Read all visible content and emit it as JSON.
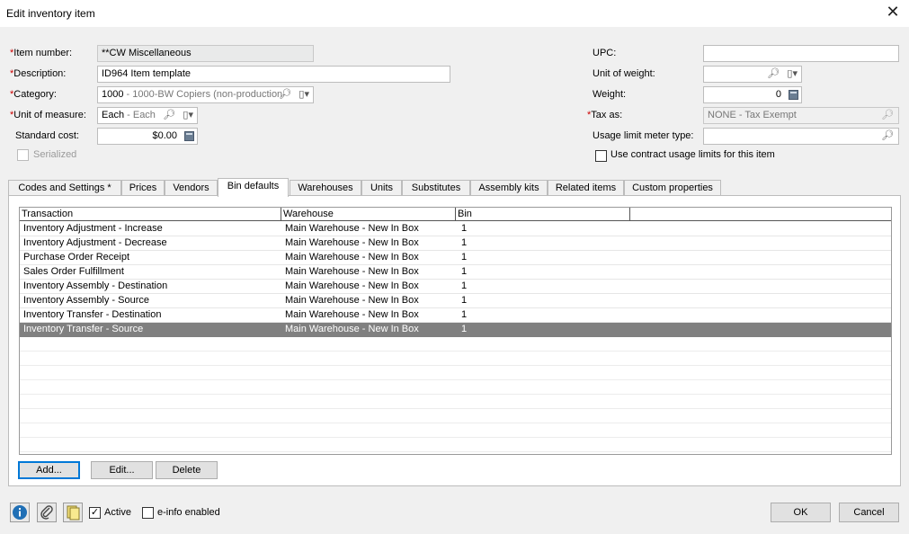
{
  "window": {
    "title": "Edit inventory item",
    "close_glyph": "✕"
  },
  "form": {
    "item_number": {
      "label": "Item number:",
      "value": "**CW Miscellaneous"
    },
    "description": {
      "label": "Description:",
      "value": "ID964 Item template"
    },
    "category": {
      "label": "Category:",
      "code": "1000",
      "name": " - 1000-BW Copiers (non-production"
    },
    "unit_of_measure": {
      "label": "Unit of measure:",
      "code": "Each",
      "name": " - Each"
    },
    "standard_cost": {
      "label": "Standard cost:",
      "value": "$0.00"
    },
    "serialized": {
      "label": "Serialized",
      "checked": false
    },
    "upc": {
      "label": "UPC:",
      "value": ""
    },
    "unit_of_weight": {
      "label": "Unit of weight:",
      "value": ""
    },
    "weight": {
      "label": "Weight:",
      "value": "0"
    },
    "tax_as": {
      "label": "Tax as:",
      "value": "NONE - Tax Exempt"
    },
    "usage_limit_meter_type": {
      "label": "Usage limit meter type:",
      "value": ""
    },
    "contract_usage": {
      "label": "Use contract usage limits for this item",
      "checked": false
    }
  },
  "tabs": [
    {
      "label": "Codes and Settings  *"
    },
    {
      "label": "Prices"
    },
    {
      "label": "Vendors"
    },
    {
      "label": "Bin defaults",
      "active": true
    },
    {
      "label": "Warehouses"
    },
    {
      "label": "Units"
    },
    {
      "label": "Substitutes"
    },
    {
      "label": "Assembly kits"
    },
    {
      "label": "Related items"
    },
    {
      "label": "Custom properties"
    }
  ],
  "grid": {
    "columns": [
      "Transaction",
      "Warehouse",
      "Bin"
    ],
    "rows": [
      {
        "transaction": "Inventory Adjustment - Increase",
        "warehouse": "Main Warehouse - New In Box",
        "bin": "1"
      },
      {
        "transaction": "Inventory Adjustment - Decrease",
        "warehouse": "Main Warehouse - New In Box",
        "bin": "1"
      },
      {
        "transaction": "Purchase Order Receipt",
        "warehouse": "Main Warehouse - New In Box",
        "bin": "1"
      },
      {
        "transaction": "Sales Order Fulfillment",
        "warehouse": "Main Warehouse - New In Box",
        "bin": "1"
      },
      {
        "transaction": "Inventory Assembly - Destination",
        "warehouse": "Main Warehouse - New In Box",
        "bin": "1"
      },
      {
        "transaction": "Inventory Assembly - Source",
        "warehouse": "Main Warehouse - New In Box",
        "bin": "1"
      },
      {
        "transaction": "Inventory Transfer - Destination",
        "warehouse": "Main Warehouse - New In Box",
        "bin": "1"
      },
      {
        "transaction": "Inventory Transfer - Source",
        "warehouse": "Main Warehouse - New In Box",
        "bin": "1",
        "selected": true
      }
    ],
    "buttons": {
      "add": "Add...",
      "edit": "Edit...",
      "delete": "Delete"
    }
  },
  "footer": {
    "active": {
      "label": "Active",
      "checked": true
    },
    "einfo": {
      "label": "e-info enabled",
      "checked": false
    },
    "ok": "OK",
    "cancel": "Cancel"
  },
  "colors": {
    "required": "#cc0000",
    "selection": "#808080",
    "info_icon": "#1f6fb5"
  },
  "icons": [
    "info-icon",
    "attachment-icon",
    "notes-icon",
    "lookup-icon",
    "dropdown-icon",
    "calculator-icon",
    "close-icon"
  ]
}
